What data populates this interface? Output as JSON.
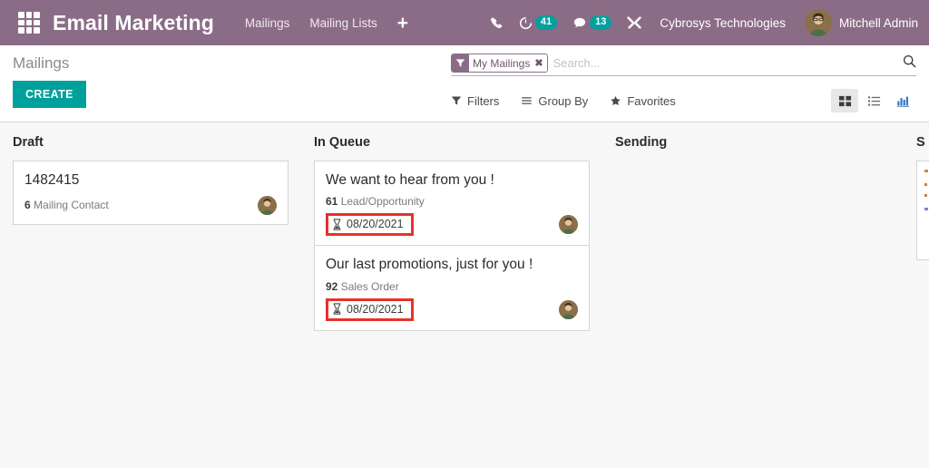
{
  "navbar": {
    "apps_icon": "apps-grid-icon",
    "brand": "Email Marketing",
    "menu": [
      {
        "label": "Mailings"
      },
      {
        "label": "Mailing Lists"
      }
    ],
    "plus_label": "+",
    "icons": [
      {
        "name": "phone-icon"
      },
      {
        "name": "activity-clock-icon",
        "badge": "41"
      },
      {
        "name": "messages-icon",
        "badge": "13"
      },
      {
        "name": "debug-tools-icon"
      }
    ],
    "company": "Cybrosys Technologies",
    "user": "Mitchell Admin"
  },
  "control_panel": {
    "breadcrumb": "Mailings",
    "create_label": "CREATE",
    "search": {
      "facet_label": "My Mailings",
      "facet_remove": "✖",
      "placeholder": "Search...",
      "value": ""
    },
    "tools": [
      {
        "name": "filters",
        "label": "Filters"
      },
      {
        "name": "group-by",
        "label": "Group By"
      },
      {
        "name": "favorites",
        "label": "Favorites"
      }
    ],
    "views": [
      {
        "name": "kanban",
        "active": true
      },
      {
        "name": "list",
        "active": false
      },
      {
        "name": "graph",
        "active": false
      }
    ]
  },
  "kanban": {
    "columns": [
      {
        "title": "Draft",
        "cards": [
          {
            "title": "1482415",
            "count": "6",
            "model": "Mailing Contact",
            "schedule": null,
            "annotated": false
          }
        ]
      },
      {
        "title": "In Queue",
        "cards": [
          {
            "title": "We want to hear from you !",
            "count": "61",
            "model": "Lead/Opportunity",
            "schedule": "08/20/2021",
            "annotated": true
          },
          {
            "title": "Our last promotions, just for you !",
            "count": "92",
            "model": "Sales Order",
            "schedule": "08/20/2021",
            "annotated": true
          }
        ]
      },
      {
        "title": "Sending",
        "cards": []
      },
      {
        "title": "S",
        "cards": [
          {
            "clipped": true
          }
        ]
      }
    ]
  },
  "colors": {
    "brand_purple": "#8B6C86",
    "accent_teal": "#00A09D",
    "annotation_red": "#E8312A",
    "kanban_bg": "#f7f7f7"
  }
}
